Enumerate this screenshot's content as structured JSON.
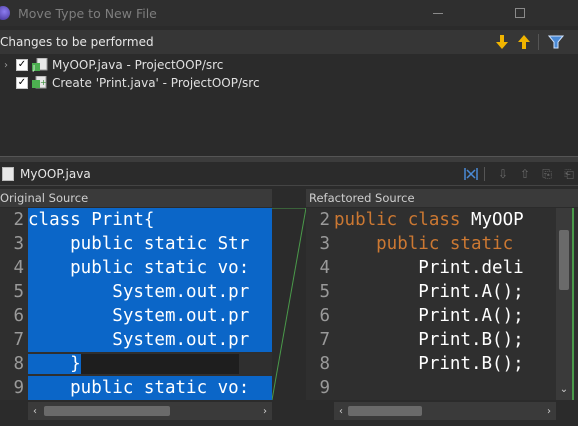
{
  "window": {
    "title": "Move Type to New File"
  },
  "changes": {
    "header": "Changes to be performed",
    "items": [
      {
        "label": "MyOOP.java - ProjectOOP/src",
        "checked": true
      },
      {
        "label": "Create 'Print.java' - ProjectOOP/src",
        "checked": true
      }
    ]
  },
  "compare": {
    "file_name": "MyOOP.java",
    "original_title": "Original Source",
    "refactored_title": "Refactored Source",
    "original_lines": [
      {
        "num": "2",
        "text": "class Print{"
      },
      {
        "num": "3",
        "text": "    public static Str"
      },
      {
        "num": "4",
        "text": "    public static vo:"
      },
      {
        "num": "5",
        "text": "        System.out.pr"
      },
      {
        "num": "6",
        "text": "        System.out.pr"
      },
      {
        "num": "7",
        "text": "        System.out.pr"
      },
      {
        "num": "8",
        "text": "    }"
      },
      {
        "num": "9",
        "text": "    public static vo:"
      }
    ],
    "refactored_lines": [
      {
        "num": "2",
        "kw": "public class ",
        "rest": "MyOOP"
      },
      {
        "num": "3",
        "kw": "    public static",
        "rest": ""
      },
      {
        "num": "4",
        "kw": "",
        "rest": "        Print.deli"
      },
      {
        "num": "5",
        "kw": "",
        "rest": "        Print.A();"
      },
      {
        "num": "6",
        "kw": "",
        "rest": "        Print.A();"
      },
      {
        "num": "7",
        "kw": "",
        "rest": "        Print.B();"
      },
      {
        "num": "8",
        "kw": "",
        "rest": "        Print.B();"
      },
      {
        "num": "9",
        "kw": "",
        "rest": ""
      }
    ]
  },
  "icons": {
    "app": "eclipse-icon",
    "minimize": "minimize-icon",
    "maximize": "maximize-icon",
    "next_change": "arrow-down-icon",
    "prev_change": "arrow-up-icon",
    "filter": "filter-icon",
    "java_file": "java-file-icon"
  },
  "colors": {
    "selection": "#0b66c8",
    "keyword": "#cc7832",
    "arrow_yellow": "#f0b400",
    "filter_blue": "#4a8ad6"
  }
}
